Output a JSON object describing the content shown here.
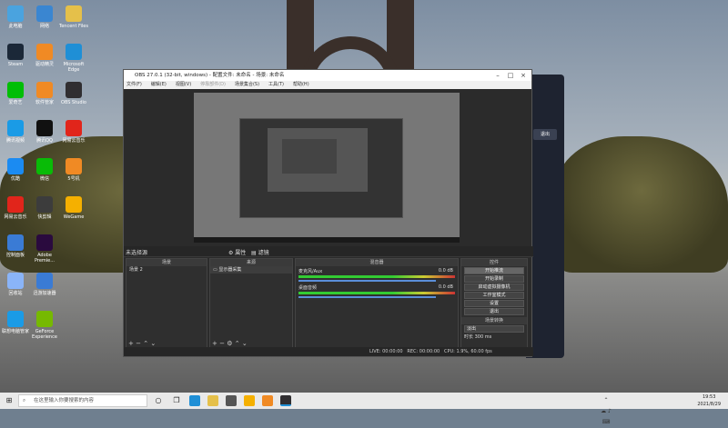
{
  "desktop": {
    "icons": [
      {
        "label": "此电脑",
        "color": "#4aa3df"
      },
      {
        "label": "网络",
        "color": "#3a86d1"
      },
      {
        "label": "Tencent Files",
        "color": "#e5c04a"
      },
      {
        "label": "Steam",
        "color": "#1b2838"
      },
      {
        "label": "驱动精灵",
        "color": "#f08a24"
      },
      {
        "label": "Microsoft Edge",
        "color": "#1f8fd6"
      },
      {
        "label": "爱奇艺",
        "color": "#00be06"
      },
      {
        "label": "软件管家",
        "color": "#f08a24"
      },
      {
        "label": "OBS Studio",
        "color": "#302e31"
      },
      {
        "label": "腾讯视频",
        "color": "#1a9be6"
      },
      {
        "label": "腾讯QQ",
        "color": "#111"
      },
      {
        "label": "网易云音乐",
        "color": "#e1251b"
      },
      {
        "label": "优酷",
        "color": "#1b8bf2"
      },
      {
        "label": "微信",
        "color": "#09bb07"
      },
      {
        "label": "5号机",
        "color": "#f08a24"
      },
      {
        "label": "网易云音乐",
        "color": "#e1251b"
      },
      {
        "label": "快剪辑",
        "color": "#3c3c3c"
      },
      {
        "label": "WeGame",
        "color": "#f5b000"
      },
      {
        "label": "控制面板",
        "color": "#3a7bd5"
      },
      {
        "label": "Adobe Premie...",
        "color": "#2a0a3e"
      },
      {
        "label": "回收站",
        "color": "#8ab4f8"
      },
      {
        "label": "迅游加速器",
        "color": "#3a7bd5"
      },
      {
        "label": "联想电脑管家",
        "color": "#1a9be6"
      },
      {
        "label": "GeForce Experience",
        "color": "#76b900"
      }
    ]
  },
  "back_window": {
    "button": "退出"
  },
  "obs": {
    "title": "OBS 27.0.1 (32-bit, windows) - 配置文件: 未命名 - 场景: 未命名",
    "menu": [
      "文件(F)",
      "编辑(E)",
      "视图(V)",
      "停靠部件(D)",
      "场景集合(S)",
      "工具(T)",
      "帮助(H)"
    ],
    "status_source": "未选择源",
    "props_label": "属性",
    "filters_label": "滤镜",
    "docks": {
      "scenes": {
        "title": "场景",
        "items": [
          "场景 2"
        ]
      },
      "sources": {
        "title": "来源",
        "items": [
          "显示器采集"
        ]
      },
      "mixer": {
        "title": "混音器",
        "channels": [
          {
            "name": "麦克风/Aux",
            "db": "0.0 dB"
          },
          {
            "name": "桌面音频",
            "db": "0.0 dB"
          }
        ]
      },
      "controls": {
        "title": "控件",
        "buttons": [
          "开始推流",
          "开始录制",
          "启动虚拟摄像机",
          "工作室模式",
          "设置",
          "退出"
        ]
      },
      "transition": {
        "title": "场景转换",
        "type": "淡出",
        "duration_label": "时长",
        "duration": "300 ms"
      }
    },
    "status_bar": {
      "live": "LIVE: 00:00:00",
      "rec": "REC: 00:00:00",
      "cpu": "CPU: 1.9%, 60.00 fps"
    }
  },
  "taskbar": {
    "search_placeholder": "在这里输入你要搜索的内容",
    "time": "19:53",
    "date": "2021/8/29"
  }
}
